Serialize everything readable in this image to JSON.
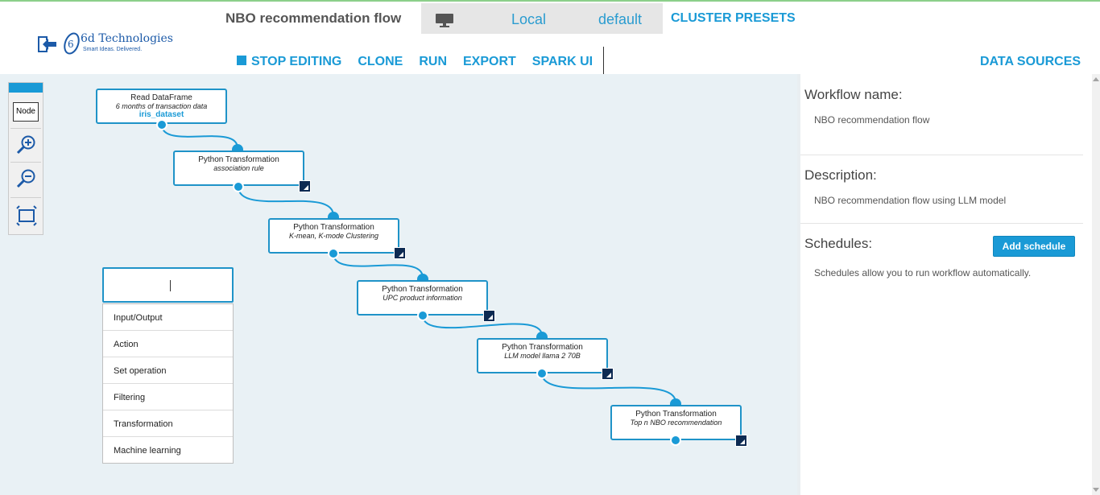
{
  "header": {
    "logo_name": "6d Technologies",
    "logo_tagline": "Smart Ideas. Delivered.",
    "flow_title": "NBO recommendation flow",
    "cluster": {
      "location": "Local",
      "profile": "default"
    },
    "cluster_presets_label": "CLUSTER PRESETS",
    "toolbar": {
      "stop_editing": "STOP EDITING",
      "clone": "CLONE",
      "run": "RUN",
      "export": "EXPORT",
      "spark_ui": "SPARK UI"
    },
    "data_sources_label": "DATA SOURCES",
    "icons": [
      "back-arrow-icon",
      "monitor-icon"
    ]
  },
  "tools": {
    "node_label": "Node",
    "icons": [
      "zoom-in-icon",
      "zoom-out-icon",
      "fit-screen-icon"
    ]
  },
  "nodes": [
    {
      "title": "Read DataFrame",
      "subtitle": "6 months of transaction data",
      "link": "iris_dataset"
    },
    {
      "title": "Python Transformation",
      "subtitle": "association rule"
    },
    {
      "title": "Python Transformation",
      "subtitle": "K-mean, K-mode Clustering"
    },
    {
      "title": "Python Transformation",
      "subtitle": "UPC product information"
    },
    {
      "title": "Python Transformation",
      "subtitle": "LLM model llama 2 70B"
    },
    {
      "title": "Python Transformation",
      "subtitle": "Top n NBO recommendation"
    }
  ],
  "node_search": {
    "value": "",
    "categories": [
      "Input/Output",
      "Action",
      "Set operation",
      "Filtering",
      "Transformation",
      "Machine learning"
    ]
  },
  "panel": {
    "workflow_name_label": "Workflow name:",
    "workflow_name": "NBO recommendation flow",
    "description_label": "Description:",
    "description": "NBO recommendation flow using LLM model",
    "schedules_label": "Schedules:",
    "add_schedule_label": "Add schedule",
    "schedules_help": "Schedules allow you to run workflow automatically."
  },
  "colors": {
    "accent": "#1a9ad6",
    "canvas_bg": "#e9f1f5",
    "badge": "#0d2a52",
    "cluster_bg": "#e6e6e6"
  }
}
